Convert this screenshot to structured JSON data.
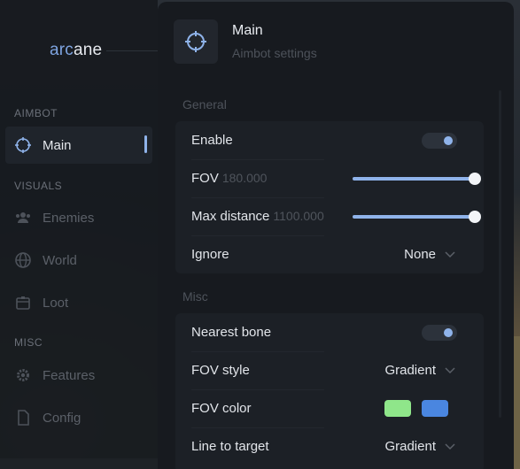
{
  "brand": {
    "prefix": "arc",
    "suffix": "ane"
  },
  "sidebar": {
    "sections": [
      {
        "title": "AIMBOT",
        "items": [
          {
            "label": "Main",
            "icon": "crosshair-icon",
            "active": true
          }
        ]
      },
      {
        "title": "VISUALS",
        "items": [
          {
            "label": "Enemies",
            "icon": "users-icon"
          },
          {
            "label": "World",
            "icon": "globe-icon"
          },
          {
            "label": "Loot",
            "icon": "box-icon"
          }
        ]
      },
      {
        "title": "MISC",
        "items": [
          {
            "label": "Features",
            "icon": "gear-icon"
          },
          {
            "label": "Config",
            "icon": "file-icon"
          }
        ]
      }
    ]
  },
  "header": {
    "title": "Main",
    "subtitle": "Aimbot settings",
    "icon": "crosshair-icon"
  },
  "general": {
    "title": "General",
    "enable": {
      "label": "Enable",
      "on": true
    },
    "fov": {
      "label": "FOV",
      "value": "180.000",
      "fraction": 1.0
    },
    "max_distance": {
      "label": "Max distance",
      "value": "1100.000",
      "fraction": 1.0
    },
    "ignore": {
      "label": "Ignore",
      "value": "None"
    }
  },
  "misc": {
    "title": "Misc",
    "nearest_bone": {
      "label": "Nearest bone",
      "on": true
    },
    "fov_style": {
      "label": "FOV style",
      "value": "Gradient"
    },
    "fov_color": {
      "label": "FOV color",
      "colors": [
        "#8fe68a",
        "#4a86e0"
      ]
    },
    "line_to_target": {
      "label": "Line to target",
      "value": "Gradient"
    }
  },
  "colors": {
    "accent": "#8fb3ea"
  }
}
